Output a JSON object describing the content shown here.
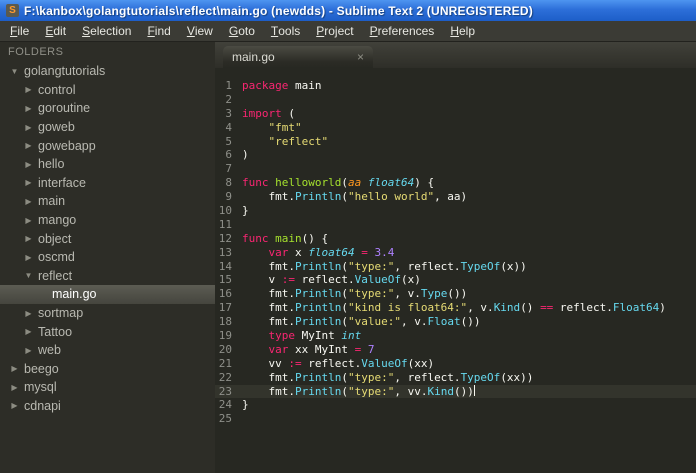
{
  "theme": {
    "colors": {
      "editor_bg": "#272822",
      "sidebar_bg": "#2d2d27",
      "menu_bg": "#3b3b35",
      "titlebar_blue": "#2d6fd9",
      "keyword": "#f92672",
      "string": "#e6db74",
      "function": "#66d9ef",
      "typename": "#66d9ef",
      "funcname": "#a6e22e",
      "param": "#fd971f",
      "number": "#ae81ff",
      "plain": "#f8f8f2",
      "gutter": "#8f908a"
    }
  },
  "window": {
    "title": "F:\\kanbox\\golangtutorials\\reflect\\main.go (newdds) - Sublime Text 2 (UNREGISTERED)",
    "app_icon_glyph": "S"
  },
  "menu": {
    "items": [
      "File",
      "Edit",
      "Selection",
      "Find",
      "View",
      "Goto",
      "Tools",
      "Project",
      "Preferences",
      "Help"
    ]
  },
  "sidebar": {
    "header": "FOLDERS",
    "items": [
      {
        "label": "golangtutorials",
        "type": "folder",
        "level": 0,
        "expanded": true,
        "selected": false
      },
      {
        "label": "control",
        "type": "folder",
        "level": 1,
        "expanded": false,
        "selected": false
      },
      {
        "label": "goroutine",
        "type": "folder",
        "level": 1,
        "expanded": false,
        "selected": false
      },
      {
        "label": "goweb",
        "type": "folder",
        "level": 1,
        "expanded": false,
        "selected": false
      },
      {
        "label": "gowebapp",
        "type": "folder",
        "level": 1,
        "expanded": false,
        "selected": false
      },
      {
        "label": "hello",
        "type": "folder",
        "level": 1,
        "expanded": false,
        "selected": false
      },
      {
        "label": "interface",
        "type": "folder",
        "level": 1,
        "expanded": false,
        "selected": false
      },
      {
        "label": "main",
        "type": "folder",
        "level": 1,
        "expanded": false,
        "selected": false
      },
      {
        "label": "mango",
        "type": "folder",
        "level": 1,
        "expanded": false,
        "selected": false
      },
      {
        "label": "object",
        "type": "folder",
        "level": 1,
        "expanded": false,
        "selected": false
      },
      {
        "label": "oscmd",
        "type": "folder",
        "level": 1,
        "expanded": false,
        "selected": false
      },
      {
        "label": "reflect",
        "type": "folder",
        "level": 1,
        "expanded": true,
        "selected": false
      },
      {
        "label": "main.go",
        "type": "file",
        "level": 2,
        "expanded": false,
        "selected": true
      },
      {
        "label": "sortmap",
        "type": "folder",
        "level": 1,
        "expanded": false,
        "selected": false
      },
      {
        "label": "Tattoo",
        "type": "folder",
        "level": 1,
        "expanded": false,
        "selected": false
      },
      {
        "label": "web",
        "type": "folder",
        "level": 1,
        "expanded": false,
        "selected": false
      },
      {
        "label": "beego",
        "type": "folder",
        "level": 0,
        "expanded": false,
        "selected": false
      },
      {
        "label": "mysql",
        "type": "folder",
        "level": 0,
        "expanded": false,
        "selected": false
      },
      {
        "label": "cdnapi",
        "type": "folder",
        "level": 0,
        "expanded": false,
        "selected": false
      }
    ]
  },
  "tabs": [
    {
      "label": "main.go",
      "active": true,
      "close_glyph": "×"
    }
  ],
  "editor": {
    "lines": [
      {
        "num": 1,
        "segments": [
          {
            "c": "k",
            "t": "package"
          },
          {
            "c": "w",
            "t": " main"
          }
        ]
      },
      {
        "num": 2,
        "segments": []
      },
      {
        "num": 3,
        "segments": [
          {
            "c": "k",
            "t": "import"
          },
          {
            "c": "w",
            "t": " ("
          }
        ]
      },
      {
        "num": 4,
        "segments": [
          {
            "c": "w",
            "t": "    "
          },
          {
            "c": "s",
            "t": "\"fmt\""
          }
        ]
      },
      {
        "num": 5,
        "segments": [
          {
            "c": "w",
            "t": "    "
          },
          {
            "c": "s",
            "t": "\"reflect\""
          }
        ]
      },
      {
        "num": 6,
        "segments": [
          {
            "c": "w",
            "t": ")"
          }
        ]
      },
      {
        "num": 7,
        "segments": []
      },
      {
        "num": 8,
        "segments": [
          {
            "c": "k",
            "t": "func"
          },
          {
            "c": "w",
            "t": " "
          },
          {
            "c": "fn",
            "t": "helloworld"
          },
          {
            "c": "w",
            "t": "("
          },
          {
            "c": "p",
            "t": "aa"
          },
          {
            "c": "w",
            "t": " "
          },
          {
            "c": "t",
            "t": "float64"
          },
          {
            "c": "w",
            "t": ") {"
          }
        ]
      },
      {
        "num": 9,
        "segments": [
          {
            "c": "w",
            "t": "    fmt."
          },
          {
            "c": "f",
            "t": "Println"
          },
          {
            "c": "w",
            "t": "("
          },
          {
            "c": "s",
            "t": "\"hello world\""
          },
          {
            "c": "w",
            "t": ", aa)"
          }
        ]
      },
      {
        "num": 10,
        "segments": [
          {
            "c": "w",
            "t": "}"
          }
        ]
      },
      {
        "num": 11,
        "segments": []
      },
      {
        "num": 12,
        "segments": [
          {
            "c": "k",
            "t": "func"
          },
          {
            "c": "w",
            "t": " "
          },
          {
            "c": "fn",
            "t": "main"
          },
          {
            "c": "w",
            "t": "() {"
          }
        ]
      },
      {
        "num": 13,
        "segments": [
          {
            "c": "w",
            "t": "    "
          },
          {
            "c": "k",
            "t": "var"
          },
          {
            "c": "w",
            "t": " x "
          },
          {
            "c": "t",
            "t": "float64"
          },
          {
            "c": "w",
            "t": " "
          },
          {
            "c": "k",
            "t": "="
          },
          {
            "c": "w",
            "t": " "
          },
          {
            "c": "n",
            "t": "3.4"
          }
        ]
      },
      {
        "num": 14,
        "segments": [
          {
            "c": "w",
            "t": "    fmt."
          },
          {
            "c": "f",
            "t": "Println"
          },
          {
            "c": "w",
            "t": "("
          },
          {
            "c": "s",
            "t": "\"type:\""
          },
          {
            "c": "w",
            "t": ", reflect."
          },
          {
            "c": "f",
            "t": "TypeOf"
          },
          {
            "c": "w",
            "t": "(x))"
          }
        ]
      },
      {
        "num": 15,
        "segments": [
          {
            "c": "w",
            "t": "    v "
          },
          {
            "c": "k",
            "t": ":="
          },
          {
            "c": "w",
            "t": " reflect."
          },
          {
            "c": "f",
            "t": "ValueOf"
          },
          {
            "c": "w",
            "t": "(x)"
          }
        ]
      },
      {
        "num": 16,
        "segments": [
          {
            "c": "w",
            "t": "    fmt."
          },
          {
            "c": "f",
            "t": "Println"
          },
          {
            "c": "w",
            "t": "("
          },
          {
            "c": "s",
            "t": "\"type:\""
          },
          {
            "c": "w",
            "t": ", v."
          },
          {
            "c": "f",
            "t": "Type"
          },
          {
            "c": "w",
            "t": "())"
          }
        ]
      },
      {
        "num": 17,
        "segments": [
          {
            "c": "w",
            "t": "    fmt."
          },
          {
            "c": "f",
            "t": "Println"
          },
          {
            "c": "w",
            "t": "("
          },
          {
            "c": "s",
            "t": "\"kind is float64:\""
          },
          {
            "c": "w",
            "t": ", v."
          },
          {
            "c": "f",
            "t": "Kind"
          },
          {
            "c": "w",
            "t": "() "
          },
          {
            "c": "k",
            "t": "=="
          },
          {
            "c": "w",
            "t": " reflect."
          },
          {
            "c": "f",
            "t": "Float64"
          },
          {
            "c": "w",
            "t": ")"
          }
        ]
      },
      {
        "num": 18,
        "segments": [
          {
            "c": "w",
            "t": "    fmt."
          },
          {
            "c": "f",
            "t": "Println"
          },
          {
            "c": "w",
            "t": "("
          },
          {
            "c": "s",
            "t": "\"value:\""
          },
          {
            "c": "w",
            "t": ", v."
          },
          {
            "c": "f",
            "t": "Float"
          },
          {
            "c": "w",
            "t": "())"
          }
        ]
      },
      {
        "num": 19,
        "segments": [
          {
            "c": "w",
            "t": "    "
          },
          {
            "c": "k",
            "t": "type"
          },
          {
            "c": "w",
            "t": " MyInt "
          },
          {
            "c": "t",
            "t": "int"
          }
        ]
      },
      {
        "num": 20,
        "segments": [
          {
            "c": "w",
            "t": "    "
          },
          {
            "c": "k",
            "t": "var"
          },
          {
            "c": "w",
            "t": " xx MyInt "
          },
          {
            "c": "k",
            "t": "="
          },
          {
            "c": "w",
            "t": " "
          },
          {
            "c": "n",
            "t": "7"
          }
        ]
      },
      {
        "num": 21,
        "segments": [
          {
            "c": "w",
            "t": "    vv "
          },
          {
            "c": "k",
            "t": ":="
          },
          {
            "c": "w",
            "t": " reflect."
          },
          {
            "c": "f",
            "t": "ValueOf"
          },
          {
            "c": "w",
            "t": "(xx)"
          }
        ]
      },
      {
        "num": 22,
        "segments": [
          {
            "c": "w",
            "t": "    fmt."
          },
          {
            "c": "f",
            "t": "Println"
          },
          {
            "c": "w",
            "t": "("
          },
          {
            "c": "s",
            "t": "\"type:\""
          },
          {
            "c": "w",
            "t": ", reflect."
          },
          {
            "c": "f",
            "t": "TypeOf"
          },
          {
            "c": "w",
            "t": "(xx))"
          }
        ]
      },
      {
        "num": 23,
        "current": true,
        "cursor": true,
        "segments": [
          {
            "c": "w",
            "t": "    fmt."
          },
          {
            "c": "f",
            "t": "Println"
          },
          {
            "c": "w",
            "t": "("
          },
          {
            "c": "s",
            "t": "\"type:\""
          },
          {
            "c": "w",
            "t": ", vv."
          },
          {
            "c": "f",
            "t": "Kind"
          },
          {
            "c": "w",
            "t": "())"
          }
        ]
      },
      {
        "num": 24,
        "segments": [
          {
            "c": "w",
            "t": "}"
          }
        ]
      },
      {
        "num": 25,
        "segments": []
      }
    ]
  }
}
